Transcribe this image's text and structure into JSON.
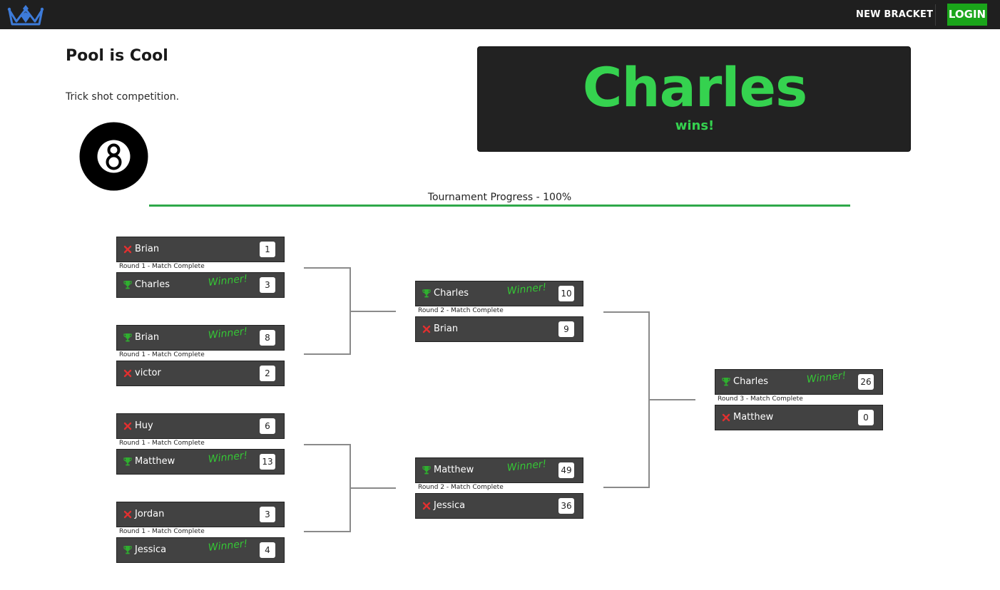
{
  "nav": {
    "new_bracket": "NEW BRACKET",
    "login": "LOGIN"
  },
  "tournament": {
    "title": "Pool is Cool",
    "description": "Trick shot competition.",
    "icon": "eight-ball-icon"
  },
  "champion": {
    "name": "Charles",
    "subtitle": "wins!"
  },
  "progress": {
    "label": "Tournament Progress - 100%",
    "percent": 100
  },
  "labels": {
    "winner": "Winner!"
  },
  "colors": {
    "accent_green": "#35d24f",
    "nav_bg": "#1f1f1f",
    "login_bg": "#1aa51a",
    "match_bg": "#424242",
    "loser_x": "#e03030",
    "progress": "#2ea84a"
  },
  "matches": [
    {
      "round": 1,
      "status": "Round 1 - Match Complete",
      "players": [
        {
          "name": "Brian",
          "score": "1",
          "winner": false
        },
        {
          "name": "Charles",
          "score": "3",
          "winner": true
        }
      ]
    },
    {
      "round": 1,
      "status": "Round 1 - Match Complete",
      "players": [
        {
          "name": "Brian",
          "score": "8",
          "winner": true
        },
        {
          "name": "victor",
          "score": "2",
          "winner": false
        }
      ]
    },
    {
      "round": 1,
      "status": "Round 1 - Match Complete",
      "players": [
        {
          "name": "Huy",
          "score": "6",
          "winner": false
        },
        {
          "name": "Matthew",
          "score": "13",
          "winner": true
        }
      ]
    },
    {
      "round": 1,
      "status": "Round 1 - Match Complete",
      "players": [
        {
          "name": "Jordan",
          "score": "3",
          "winner": false
        },
        {
          "name": "Jessica",
          "score": "4",
          "winner": true
        }
      ]
    },
    {
      "round": 2,
      "status": "Round 2 - Match Complete",
      "players": [
        {
          "name": "Charles",
          "score": "10",
          "winner": true
        },
        {
          "name": "Brian",
          "score": "9",
          "winner": false
        }
      ]
    },
    {
      "round": 2,
      "status": "Round 2 - Match Complete",
      "players": [
        {
          "name": "Matthew",
          "score": "49",
          "winner": true
        },
        {
          "name": "Jessica",
          "score": "36",
          "winner": false
        }
      ]
    },
    {
      "round": 3,
      "status": "Round 3 - Match Complete",
      "players": [
        {
          "name": "Charles",
          "score": "26",
          "winner": true
        },
        {
          "name": "Matthew",
          "score": "0",
          "winner": false
        }
      ]
    }
  ]
}
